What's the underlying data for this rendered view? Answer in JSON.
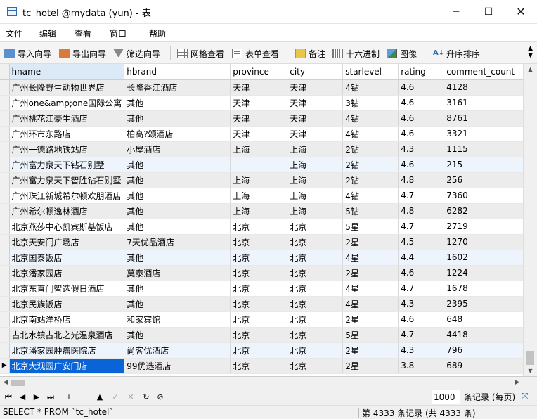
{
  "window": {
    "title": "tc_hotel @mydata (yun) - 表",
    "min_label": "─",
    "max_label": "☐",
    "close_label": "✕"
  },
  "menu": [
    "文件",
    "编辑",
    "查看",
    "窗口",
    "帮助"
  ],
  "toolbar": {
    "import": "导入向导",
    "export": "导出向导",
    "filter": "筛选向导",
    "grid_view": "网格查看",
    "form_view": "表单查看",
    "memo": "备注",
    "hex": "十六进制",
    "image": "图像",
    "sort": "升序排序"
  },
  "table": {
    "columns": [
      "hname",
      "hbrand",
      "province",
      "city",
      "starlevel",
      "rating",
      "comment_count"
    ],
    "rows": [
      [
        "广州长隆野生动物世界店",
        "长隆香江酒店",
        "天津",
        "天津",
        "4钻",
        "4.6",
        "4128"
      ],
      [
        "广州one&amp;one国际公寓",
        "其他",
        "天津",
        "天津",
        "3钻",
        "4.6",
        "3161"
      ],
      [
        "广州桃花江豪生酒店",
        "其他",
        "天津",
        "天津",
        "4钻",
        "4.6",
        "8761"
      ],
      [
        "广州环市东路店",
        "柏高?颂酒店",
        "天津",
        "天津",
        "4钻",
        "4.6",
        "3321"
      ],
      [
        "广州一德路地铁站店",
        "小屋酒店",
        "上海",
        "上海",
        "2钻",
        "4.3",
        "1115"
      ],
      [
        "广州富力泉天下钻石别墅",
        "其他",
        "",
        "上海",
        "2钻",
        "4.6",
        "215"
      ],
      [
        "广州富力泉天下智胜钻石别墅",
        "其他",
        "上海",
        "上海",
        "2钻",
        "4.8",
        "256"
      ],
      [
        "广州珠江新城希尔顿欢朋酒店",
        "其他",
        "上海",
        "上海",
        "4钻",
        "4.7",
        "7360"
      ],
      [
        "广州希尔顿逸林酒店",
        "其他",
        "上海",
        "上海",
        "5钻",
        "4.8",
        "6282"
      ],
      [
        "北京燕莎中心凯宾斯基饭店",
        "其他",
        "北京",
        "北京",
        "5星",
        "4.7",
        "2719"
      ],
      [
        "北京天安门广场店",
        "7天优品酒店",
        "北京",
        "北京",
        "2星",
        "4.5",
        "1270"
      ],
      [
        "北京国泰饭店",
        "其他",
        "北京",
        "北京",
        "4星",
        "4.4",
        "1602"
      ],
      [
        "北京潘家园店",
        "莫泰酒店",
        "北京",
        "北京",
        "2星",
        "4.6",
        "1224"
      ],
      [
        "北京东直门智选假日酒店",
        "其他",
        "北京",
        "北京",
        "4星",
        "4.7",
        "1678"
      ],
      [
        "北京民族饭店",
        "其他",
        "北京",
        "北京",
        "4星",
        "4.3",
        "2395"
      ],
      [
        "北京南站洋桥店",
        "和家宾馆",
        "北京",
        "北京",
        "2星",
        "4.6",
        "648"
      ],
      [
        "古北水镇古北之光温泉酒店",
        "其他",
        "北京",
        "北京",
        "5星",
        "4.7",
        "4418"
      ],
      [
        "北京潘家园肿瘤医院店",
        "尚客优酒店",
        "北京",
        "北京",
        "2星",
        "4.3",
        "796"
      ],
      [
        "北京大观园广安门店",
        "99优选酒店",
        "北京",
        "北京",
        "2星",
        "3.8",
        "689"
      ]
    ],
    "current_row_marker": "▶"
  },
  "navigator": {
    "buttons": [
      "⏮",
      "◀",
      "▶",
      "⏭",
      "+",
      "−",
      "▲",
      "✓",
      "✕",
      "↻",
      "⊘"
    ],
    "limit_value": "1000",
    "limit_label": "条记录 (每页)",
    "end_label": "⤧"
  },
  "status": {
    "sql": "SELECT * FROM `tc_hotel`",
    "record_info": "第 4333 条记录 (共 4333 条)"
  }
}
